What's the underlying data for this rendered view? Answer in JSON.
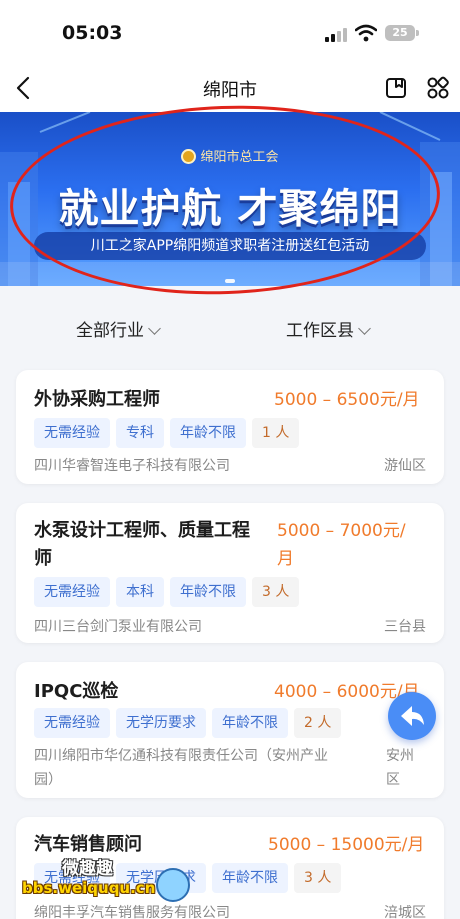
{
  "status_bar": {
    "time": "05:03",
    "battery": "25"
  },
  "nav": {
    "title": "绵阳市",
    "back_icon": "back-icon",
    "bookmark_icon": "bookmark-icon",
    "grid_icon": "grid-icon"
  },
  "banner": {
    "org": "绵阳市总工会",
    "headline": "就业护航 才聚绵阳",
    "subtitle": "川工之家APP绵阳频道求职者注册送红包活动"
  },
  "filters": {
    "industry": "全部行业",
    "district": "工作区县"
  },
  "jobs": [
    {
      "title": "外协采购工程师",
      "salary": "5000 – 6500元/月",
      "tags": [
        "无需经验",
        "专科",
        "年龄不限"
      ],
      "count": "1 人",
      "company": "四川华睿智连电子科技有限公司",
      "district": "游仙区"
    },
    {
      "title_line1": "水泵设计工程师、质量工程",
      "title_line2": "师",
      "salary_line1": "5000 – 7000元/",
      "salary_line2": "月",
      "tags": [
        "无需经验",
        "本科",
        "年龄不限"
      ],
      "count": "3 人",
      "company": "四川三台剑门泵业有限公司",
      "district": "三台县"
    },
    {
      "title": "IPQC巡检",
      "salary": "4000 – 6000元/月",
      "tags": [
        "无需经验",
        "无学历要求",
        "年龄不限"
      ],
      "count": "2 人",
      "company_line1": "四川绵阳市华亿通科技有限责任公司（安州产业",
      "company_line2": "园）",
      "district_line1": "安州",
      "district_line2": "区"
    },
    {
      "title": "汽车销售顾问",
      "salary": "5000 – 15000元/月",
      "tags": [
        "无需经验",
        "无学历要求",
        "年龄不限"
      ],
      "count": "3 人",
      "company": "绵阳丰孚汽车销售服务有限公司",
      "district": "涪城区"
    }
  ],
  "watermark": {
    "top": "微趣趣",
    "url": "bbs.weiququ.cn"
  },
  "colors": {
    "accent_blue": "#3e6fcf",
    "salary_orange": "#f07b2c",
    "annotation_red": "#e0241b"
  }
}
